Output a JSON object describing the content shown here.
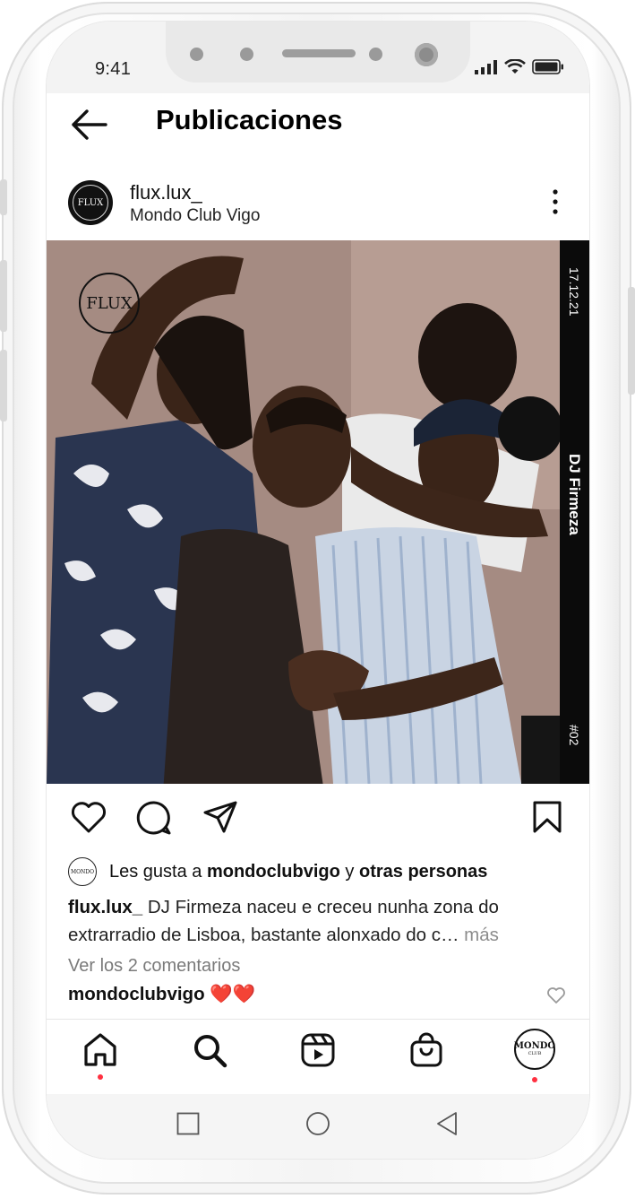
{
  "status_bar": {
    "time": "9:41"
  },
  "header": {
    "title": "Publicaciones"
  },
  "post": {
    "username": "flux.lux_",
    "location": "Mondo Club Vigo",
    "avatar_text": "FLUX",
    "image": {
      "logo_text": "FLUX",
      "band_date": "17.12.21",
      "band_artist": "DJ Firmeza",
      "band_number": "#02"
    },
    "likes": {
      "avatar_text": "MONDO",
      "prefix": "Les gusta a ",
      "user": "mondoclubvigo",
      "connector": " y ",
      "others": "otras personas"
    },
    "caption": {
      "user": "flux.lux_",
      "text": " DJ Firmeza naceu e creceu nunha zona do extrarradio de Lisboa, bastante alonxado do c…",
      "more": " más"
    },
    "comments_link": "Ver los 2 comentarios",
    "comment": {
      "user": "mondoclubvigo",
      "text": " ❤️❤️"
    }
  },
  "bottom_nav": {
    "profile_avatar_text": "MONDO",
    "profile_avatar_sub": "CLUB"
  },
  "colors": {
    "accent_dot": "#ff3040",
    "heart": "#e0245e"
  }
}
